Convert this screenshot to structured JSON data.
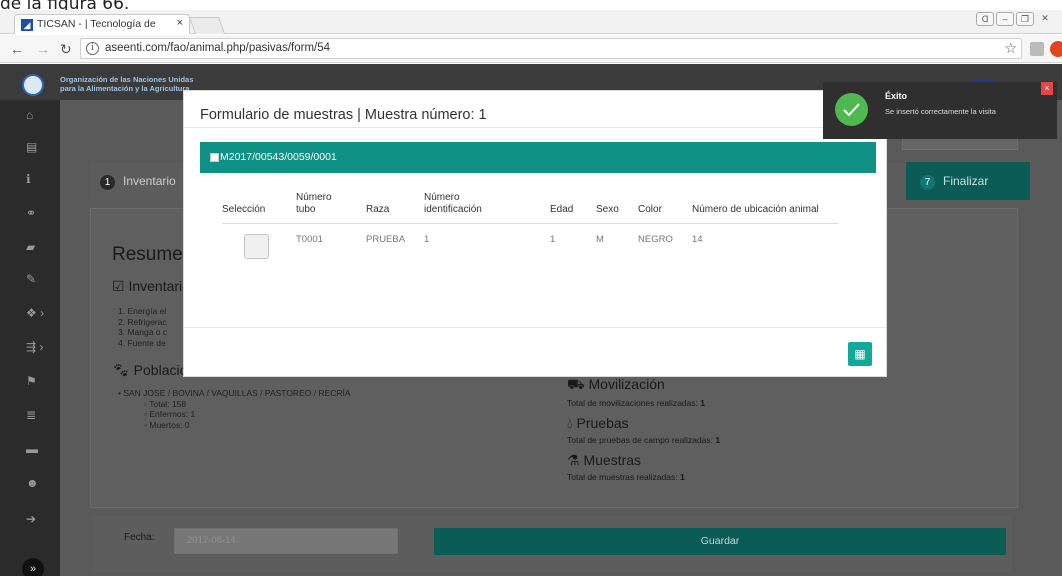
{
  "caption": "de la figura 66.",
  "browser": {
    "tab_title": "TICSAN - | Tecnología de",
    "tab_close": "×",
    "url": "aseenti.com/fao/animal.php/pasivas/form/54"
  },
  "header": {
    "org_line1": "Organización de las Naciones Unidas",
    "org_line2": "para la Alimentación y la Agricultura"
  },
  "wizard": {
    "step1_num": "1",
    "step1_label": "Inventario",
    "step7_num": "7",
    "step7_label": "Finalizar"
  },
  "summary": {
    "title": "Resumen",
    "inventario_title": "Inventario",
    "inventario_items": [
      "1. Energía el",
      "2. Refrigerac",
      "3. Manga o c",
      "4. Fuente de"
    ],
    "poblacion_title": "Población",
    "poblacion_line": "SAN JOSE / BOVINA / VAQUILLAS / PASTOREO / RECRÍA",
    "total": "Total: 158",
    "enfermos": "Enfermos: 1",
    "muertos": "Muertos: 0",
    "movilizacion_title": "Movilización",
    "movilizacion_text": "Total de movilizaciones realizadas:",
    "movilizacion_value": "1",
    "pruebas_title": "Pruebas",
    "pruebas_text": "Total de pruebas de campo realizadas:",
    "pruebas_value": "1",
    "muestras_title": "Muestras",
    "muestras_text": "Total de muestras realizadas:",
    "muestras_value": "1"
  },
  "footer": {
    "fecha_label": "Fecha:",
    "fecha_value": "2017-08-14",
    "guardar_label": "Guardar"
  },
  "modal": {
    "title": "Formulario de muestras | Muestra número: 1",
    "sample_code": "M2017/00543/0059/0001",
    "columns": [
      "Selección",
      "Número\ntubo",
      "Raza",
      "Número\nidentificación",
      "Edad",
      "Sexo",
      "Color",
      "Número de ubicación animal"
    ],
    "row": {
      "tubo": "T0001",
      "raza": "PRUEBA",
      "identificacion": "1",
      "edad": "1",
      "sexo": "M",
      "color": "NEGRO",
      "ubicacion": "14"
    }
  },
  "toast": {
    "title": "Éxito",
    "message": "Se insertó correctamente la visita"
  },
  "icons": {
    "back": "back-arrow-icon",
    "forward": "forward-arrow-icon",
    "reload": "reload-icon",
    "info": "info-icon",
    "star": "star-icon",
    "close": "close-icon",
    "check": "check-icon"
  },
  "colors": {
    "teal": "#0f9185",
    "teal_dark": "#0b5c56",
    "success": "#4fb84f",
    "danger": "#e04848"
  }
}
